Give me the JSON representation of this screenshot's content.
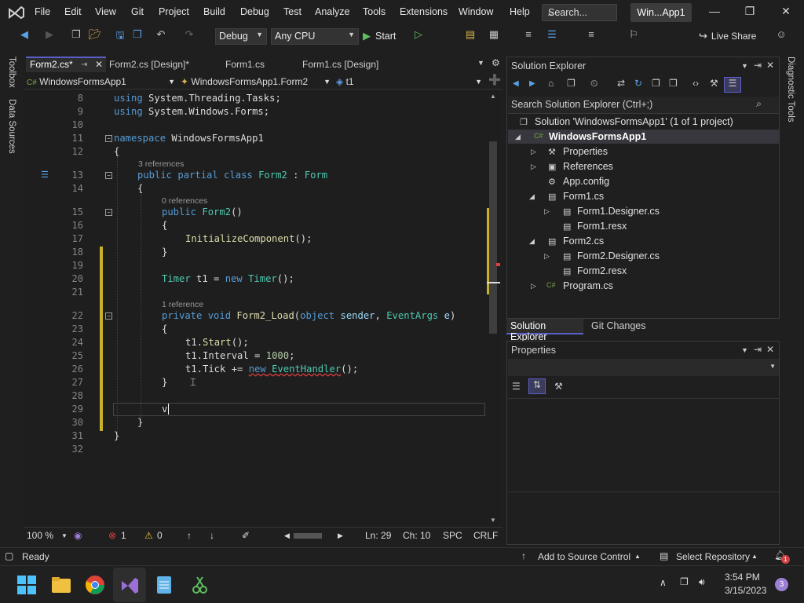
{
  "menu": [
    "File",
    "Edit",
    "View",
    "Git",
    "Project",
    "Build",
    "Debug",
    "Test",
    "Analyze",
    "Tools",
    "Extensions",
    "Window",
    "Help"
  ],
  "search": {
    "label": "Search..."
  },
  "window_title": "Win...App1",
  "toolbar": {
    "config": "Debug",
    "platform": "Any CPU",
    "start_label": "Start",
    "live_share": "Live Share"
  },
  "left_rail": {
    "toolbox": "Toolbox",
    "data_sources": "Data Sources"
  },
  "right_rail": {
    "diagnostic": "Diagnostic Tools"
  },
  "tabs": [
    {
      "label": "Form2.cs*"
    },
    {
      "label": "Form2.cs [Design]*"
    },
    {
      "label": "Form1.cs"
    },
    {
      "label": "Form1.cs [Design]"
    }
  ],
  "nav": {
    "project": "WindowsFormsApp1",
    "class": "WindowsFormsApp1.Form2",
    "member": "t1"
  },
  "code": {
    "lines": [
      "8",
      "9",
      "10",
      "11",
      "12",
      "13",
      "14",
      "15",
      "16",
      "17",
      "18",
      "19",
      "20",
      "21",
      "22",
      "23",
      "24",
      "25",
      "26",
      "27",
      "28",
      "29",
      "30",
      "31",
      "32"
    ],
    "l8a": "using",
    "l8b": " System.Threading.Tasks;",
    "l9a": "using",
    "l9b": " System.Windows.Forms;",
    "l11a": "namespace",
    "l11b": " WindowsFormsApp1",
    "brace_open": "{",
    "brace_close": "}",
    "lens13": "3 references",
    "l13a": "public partial class",
    "l13b": "Form2",
    "l13c": " : ",
    "l13d": "Form",
    "lens15": "0 references",
    "l15a": "public",
    "l15b": "Form2",
    "l15c": "()",
    "l17a": "InitializeComponent",
    "l17b": "();",
    "l20a": "Timer",
    "l20b": " t1 = ",
    "l20c": "new",
    "l20d": "Timer",
    "l20e": "();",
    "lens22": "1 reference",
    "l22a": "private void",
    "l22b": "Form2_Load",
    "l22c": "(",
    "l22d": "object",
    "l22e": "sender",
    ", ": "",
    "l22f": "EventArgs",
    "l22g": "e",
    "l22h": ")",
    "l24a": "t1.",
    "l24b": "Start",
    "l24c": "();",
    "l25a": "t1.Interval = ",
    "l25b": "1000",
    ";": "",
    "l26a": "t1.Tick += ",
    "l26b": "new",
    "l26c": "EventHandler",
    "l26d": "();",
    "l29": "v",
    "sep_comma": ", ",
    "semi": ";"
  },
  "editor_status": {
    "zoom": "100 %",
    "errors": "1",
    "warnings": "0",
    "ln": "Ln: 29",
    "ch": "Ch: 10",
    "spc": "SPC",
    "crlf": "CRLF"
  },
  "solution_explorer": {
    "title": "Solution Explorer",
    "search_placeholder": "Search Solution Explorer (Ctrl+;)",
    "items": [
      {
        "label": "Solution 'WindowsFormsApp1' (1 of 1 project)"
      },
      {
        "label": "WindowsFormsApp1"
      },
      {
        "label": "Properties"
      },
      {
        "label": "References"
      },
      {
        "label": "App.config"
      },
      {
        "label": "Form1.cs"
      },
      {
        "label": "Form1.Designer.cs"
      },
      {
        "label": "Form1.resx"
      },
      {
        "label": "Form2.cs"
      },
      {
        "label": "Form2.Designer.cs"
      },
      {
        "label": "Form2.resx"
      },
      {
        "label": "Program.cs"
      }
    ],
    "tab_active": "Solution Explorer",
    "tab_other": "Git Changes"
  },
  "properties": {
    "title": "Properties"
  },
  "status": {
    "ready": "Ready",
    "source_control": "Add to Source Control",
    "repo": "Select Repository",
    "notif_count": "1"
  },
  "taskbar": {
    "time": "3:54 PM",
    "date": "3/15/2023",
    "badge": "3"
  },
  "colors": {
    "accent": "#5b5fc7",
    "keyword": "#569cd6",
    "type": "#4ec9b0",
    "method": "#dcdcaa",
    "error": "#e04040"
  }
}
